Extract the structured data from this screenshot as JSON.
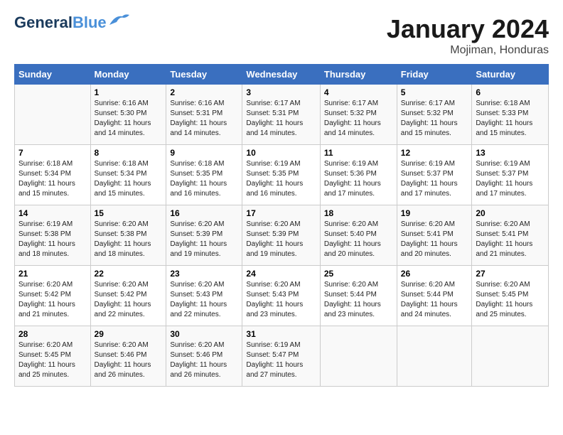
{
  "header": {
    "logo_line1": "General",
    "logo_line2": "Blue",
    "month": "January 2024",
    "location": "Mojiman, Honduras"
  },
  "days_of_week": [
    "Sunday",
    "Monday",
    "Tuesday",
    "Wednesday",
    "Thursday",
    "Friday",
    "Saturday"
  ],
  "weeks": [
    [
      {
        "day": "",
        "sunrise": "",
        "sunset": "",
        "daylight": ""
      },
      {
        "day": "1",
        "sunrise": "Sunrise: 6:16 AM",
        "sunset": "Sunset: 5:30 PM",
        "daylight": "Daylight: 11 hours and 14 minutes."
      },
      {
        "day": "2",
        "sunrise": "Sunrise: 6:16 AM",
        "sunset": "Sunset: 5:31 PM",
        "daylight": "Daylight: 11 hours and 14 minutes."
      },
      {
        "day": "3",
        "sunrise": "Sunrise: 6:17 AM",
        "sunset": "Sunset: 5:31 PM",
        "daylight": "Daylight: 11 hours and 14 minutes."
      },
      {
        "day": "4",
        "sunrise": "Sunrise: 6:17 AM",
        "sunset": "Sunset: 5:32 PM",
        "daylight": "Daylight: 11 hours and 14 minutes."
      },
      {
        "day": "5",
        "sunrise": "Sunrise: 6:17 AM",
        "sunset": "Sunset: 5:32 PM",
        "daylight": "Daylight: 11 hours and 15 minutes."
      },
      {
        "day": "6",
        "sunrise": "Sunrise: 6:18 AM",
        "sunset": "Sunset: 5:33 PM",
        "daylight": "Daylight: 11 hours and 15 minutes."
      }
    ],
    [
      {
        "day": "7",
        "sunrise": "Sunrise: 6:18 AM",
        "sunset": "Sunset: 5:34 PM",
        "daylight": "Daylight: 11 hours and 15 minutes."
      },
      {
        "day": "8",
        "sunrise": "Sunrise: 6:18 AM",
        "sunset": "Sunset: 5:34 PM",
        "daylight": "Daylight: 11 hours and 15 minutes."
      },
      {
        "day": "9",
        "sunrise": "Sunrise: 6:18 AM",
        "sunset": "Sunset: 5:35 PM",
        "daylight": "Daylight: 11 hours and 16 minutes."
      },
      {
        "day": "10",
        "sunrise": "Sunrise: 6:19 AM",
        "sunset": "Sunset: 5:35 PM",
        "daylight": "Daylight: 11 hours and 16 minutes."
      },
      {
        "day": "11",
        "sunrise": "Sunrise: 6:19 AM",
        "sunset": "Sunset: 5:36 PM",
        "daylight": "Daylight: 11 hours and 17 minutes."
      },
      {
        "day": "12",
        "sunrise": "Sunrise: 6:19 AM",
        "sunset": "Sunset: 5:37 PM",
        "daylight": "Daylight: 11 hours and 17 minutes."
      },
      {
        "day": "13",
        "sunrise": "Sunrise: 6:19 AM",
        "sunset": "Sunset: 5:37 PM",
        "daylight": "Daylight: 11 hours and 17 minutes."
      }
    ],
    [
      {
        "day": "14",
        "sunrise": "Sunrise: 6:19 AM",
        "sunset": "Sunset: 5:38 PM",
        "daylight": "Daylight: 11 hours and 18 minutes."
      },
      {
        "day": "15",
        "sunrise": "Sunrise: 6:20 AM",
        "sunset": "Sunset: 5:38 PM",
        "daylight": "Daylight: 11 hours and 18 minutes."
      },
      {
        "day": "16",
        "sunrise": "Sunrise: 6:20 AM",
        "sunset": "Sunset: 5:39 PM",
        "daylight": "Daylight: 11 hours and 19 minutes."
      },
      {
        "day": "17",
        "sunrise": "Sunrise: 6:20 AM",
        "sunset": "Sunset: 5:39 PM",
        "daylight": "Daylight: 11 hours and 19 minutes."
      },
      {
        "day": "18",
        "sunrise": "Sunrise: 6:20 AM",
        "sunset": "Sunset: 5:40 PM",
        "daylight": "Daylight: 11 hours and 20 minutes."
      },
      {
        "day": "19",
        "sunrise": "Sunrise: 6:20 AM",
        "sunset": "Sunset: 5:41 PM",
        "daylight": "Daylight: 11 hours and 20 minutes."
      },
      {
        "day": "20",
        "sunrise": "Sunrise: 6:20 AM",
        "sunset": "Sunset: 5:41 PM",
        "daylight": "Daylight: 11 hours and 21 minutes."
      }
    ],
    [
      {
        "day": "21",
        "sunrise": "Sunrise: 6:20 AM",
        "sunset": "Sunset: 5:42 PM",
        "daylight": "Daylight: 11 hours and 21 minutes."
      },
      {
        "day": "22",
        "sunrise": "Sunrise: 6:20 AM",
        "sunset": "Sunset: 5:42 PM",
        "daylight": "Daylight: 11 hours and 22 minutes."
      },
      {
        "day": "23",
        "sunrise": "Sunrise: 6:20 AM",
        "sunset": "Sunset: 5:43 PM",
        "daylight": "Daylight: 11 hours and 22 minutes."
      },
      {
        "day": "24",
        "sunrise": "Sunrise: 6:20 AM",
        "sunset": "Sunset: 5:43 PM",
        "daylight": "Daylight: 11 hours and 23 minutes."
      },
      {
        "day": "25",
        "sunrise": "Sunrise: 6:20 AM",
        "sunset": "Sunset: 5:44 PM",
        "daylight": "Daylight: 11 hours and 23 minutes."
      },
      {
        "day": "26",
        "sunrise": "Sunrise: 6:20 AM",
        "sunset": "Sunset: 5:44 PM",
        "daylight": "Daylight: 11 hours and 24 minutes."
      },
      {
        "day": "27",
        "sunrise": "Sunrise: 6:20 AM",
        "sunset": "Sunset: 5:45 PM",
        "daylight": "Daylight: 11 hours and 25 minutes."
      }
    ],
    [
      {
        "day": "28",
        "sunrise": "Sunrise: 6:20 AM",
        "sunset": "Sunset: 5:45 PM",
        "daylight": "Daylight: 11 hours and 25 minutes."
      },
      {
        "day": "29",
        "sunrise": "Sunrise: 6:20 AM",
        "sunset": "Sunset: 5:46 PM",
        "daylight": "Daylight: 11 hours and 26 minutes."
      },
      {
        "day": "30",
        "sunrise": "Sunrise: 6:20 AM",
        "sunset": "Sunset: 5:46 PM",
        "daylight": "Daylight: 11 hours and 26 minutes."
      },
      {
        "day": "31",
        "sunrise": "Sunrise: 6:19 AM",
        "sunset": "Sunset: 5:47 PM",
        "daylight": "Daylight: 11 hours and 27 minutes."
      },
      {
        "day": "",
        "sunrise": "",
        "sunset": "",
        "daylight": ""
      },
      {
        "day": "",
        "sunrise": "",
        "sunset": "",
        "daylight": ""
      },
      {
        "day": "",
        "sunrise": "",
        "sunset": "",
        "daylight": ""
      }
    ]
  ]
}
